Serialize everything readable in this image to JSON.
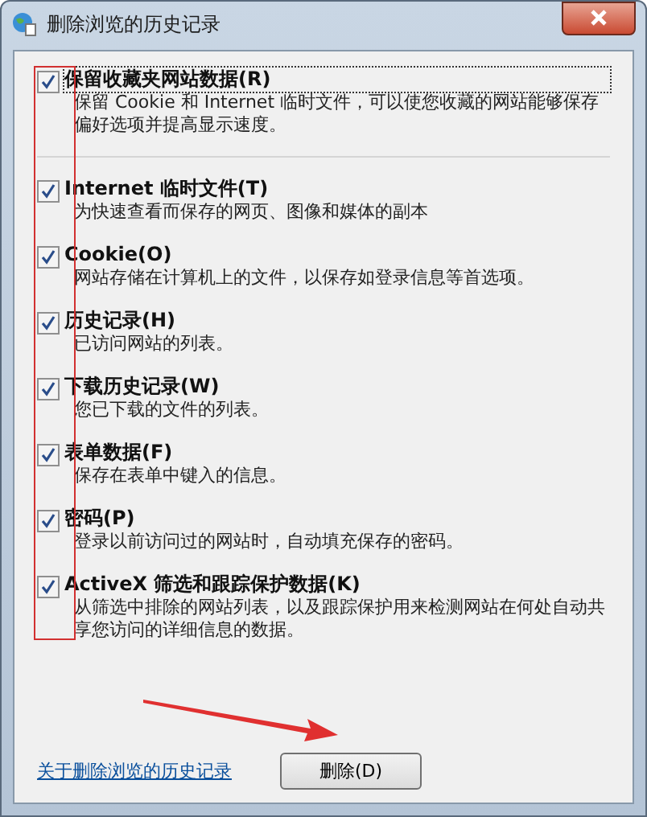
{
  "window": {
    "title": "删除浏览的历史记录"
  },
  "options": [
    {
      "label": "保留收藏夹网站数据(R)",
      "description": "保留 Cookie 和 Internet 临时文件，可以使您收藏的网站能够保存偏好选项并提高显示速度。",
      "checked": true
    },
    {
      "label": "Internet 临时文件(T)",
      "description": "为快速查看而保存的网页、图像和媒体的副本",
      "checked": true
    },
    {
      "label": "Cookie(O)",
      "description": "网站存储在计算机上的文件，以保存如登录信息等首选项。",
      "checked": true
    },
    {
      "label": "历史记录(H)",
      "description": "已访问网站的列表。",
      "checked": true
    },
    {
      "label": "下载历史记录(W)",
      "description": "您已下载的文件的列表。",
      "checked": true
    },
    {
      "label": "表单数据(F)",
      "description": "保存在表单中键入的信息。",
      "checked": true
    },
    {
      "label": "密码(P)",
      "description": "登录以前访问过的网站时，自动填充保存的密码。",
      "checked": true
    },
    {
      "label": "ActiveX 筛选和跟踪保护数据(K)",
      "description": "从筛选中排除的网站列表，以及跟踪保护用来检测网站在何处自动共享您访问的详细信息的数据。",
      "checked": true
    }
  ],
  "footer": {
    "link": "关于删除浏览的历史记录",
    "button": "删除(D)"
  }
}
